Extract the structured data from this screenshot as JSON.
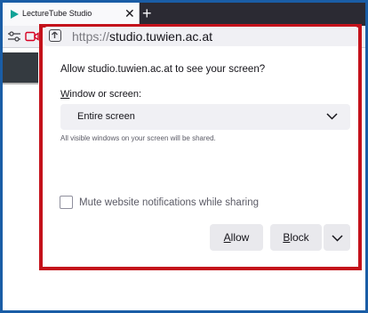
{
  "window": {
    "tab": {
      "title": "LectureTube Studio",
      "close_glyph": "✕",
      "favicon": "play-arrow-icon",
      "favicon_color": "#12a397"
    },
    "new_tab_glyph": "+"
  },
  "urlbar": {
    "scheme": "https://",
    "host": "studio.tuwien.ac.at",
    "permission_icon": "screen-share-permission-icon"
  },
  "dialog": {
    "title": "Allow studio.tuwien.ac.at to see your screen?",
    "select_label": {
      "access_key": "W",
      "rest": "indow or screen:"
    },
    "select_value": "Entire screen",
    "hint": "All visible windows on your screen will be shared.",
    "mute_label": "Mute website notifications while sharing",
    "mute_checked": false,
    "allow_button": {
      "access_key": "A",
      "rest": "llow"
    },
    "block_button": {
      "access_key": "B",
      "rest": "lock"
    },
    "more_icon": "chevron-down-icon"
  },
  "colors": {
    "highlight_border": "#c4121b",
    "window_border": "#1a5da6",
    "tabstrip": "#2b2a33",
    "camera_icon": "#d70022"
  }
}
